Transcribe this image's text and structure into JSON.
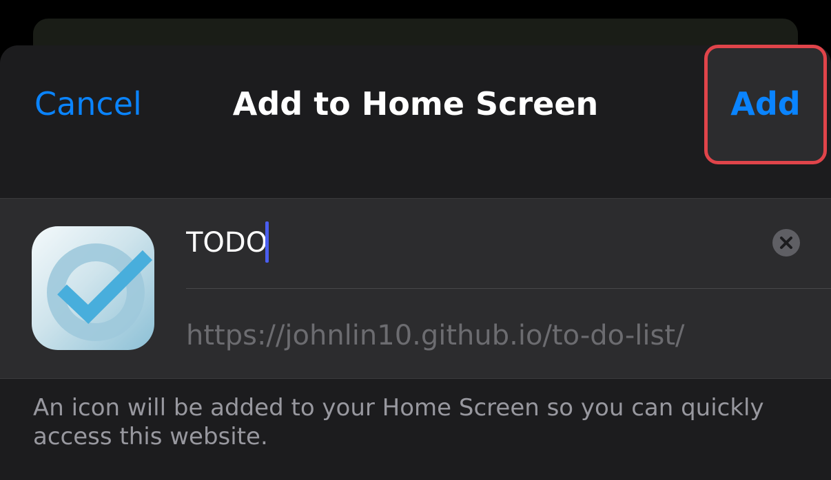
{
  "sheet": {
    "title": "Add to Home Screen",
    "cancel_label": "Cancel",
    "add_label": "Add"
  },
  "shortcut": {
    "name_value": "TODO",
    "url": "https://johnlin10.github.io/to-do-list/",
    "icon": "checkmark-circle-app-icon"
  },
  "footer": {
    "note": "An icon will be added to your Home Screen so you can quickly access this website."
  },
  "colors": {
    "accent": "#0a84ff",
    "highlight": "#e0444a",
    "background": "#1c1c1e",
    "card": "#2c2c2e"
  }
}
